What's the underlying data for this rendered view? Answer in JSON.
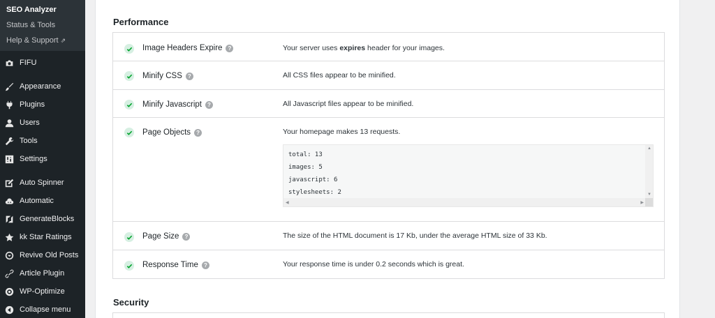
{
  "sidebar": {
    "submenu": [
      {
        "label": "SEO Analyzer",
        "current": true
      },
      {
        "label": "Status & Tools",
        "current": false
      },
      {
        "label": "Help & Support",
        "current": false,
        "external": "⇗"
      }
    ],
    "items": [
      {
        "label": "FIFU",
        "icon": "camera-icon"
      },
      {
        "label": "Appearance",
        "icon": "brush-icon"
      },
      {
        "label": "Plugins",
        "icon": "plugin-icon"
      },
      {
        "label": "Users",
        "icon": "users-icon"
      },
      {
        "label": "Tools",
        "icon": "wrench-icon"
      },
      {
        "label": "Settings",
        "icon": "settings-icon"
      },
      {
        "label": "Auto Spinner",
        "icon": "edit-icon"
      },
      {
        "label": "Automatic",
        "icon": "cloud-icon"
      },
      {
        "label": "GenerateBlocks",
        "icon": "blocks-icon"
      },
      {
        "label": "kk Star Ratings",
        "icon": "star-icon"
      },
      {
        "label": "Revive Old Posts",
        "icon": "revive-icon"
      },
      {
        "label": "Article Plugin",
        "icon": "link-icon"
      },
      {
        "label": "WP-Optimize",
        "icon": "optimize-icon"
      },
      {
        "label": "Collapse menu",
        "icon": "collapse-icon"
      }
    ]
  },
  "main": {
    "performance_title": "Performance",
    "security_title": "Security",
    "rows": [
      {
        "label": "Image Headers Expire",
        "desc_pre": "Your server uses ",
        "desc_bold": "expires",
        "desc_post": " header for your images."
      },
      {
        "label": "Minify CSS",
        "desc_pre": "All CSS files appear to be minified.",
        "desc_bold": "",
        "desc_post": ""
      },
      {
        "label": "Minify Javascript",
        "desc_pre": "All Javascript files appear to be minified.",
        "desc_bold": "",
        "desc_post": ""
      },
      {
        "label": "Page Objects",
        "desc_pre": "Your homepage makes 13 requests.",
        "desc_bold": "",
        "desc_post": ""
      },
      {
        "label": "Page Size",
        "desc_pre": "The size of the HTML document is 17 Kb, under the average HTML size of 33 Kb.",
        "desc_bold": "",
        "desc_post": ""
      },
      {
        "label": "Response Time",
        "desc_pre": "Your response time is under 0.2 seconds which is great.",
        "desc_bold": "",
        "desc_post": ""
      }
    ],
    "code_lines": [
      "total: 13",
      "images: 5",
      "javascript: 6",
      "stylesheets: 2"
    ],
    "colors": {
      "check_bg": "#d6efe2",
      "check": "#00a32a",
      "sidebar": "#1d2327"
    }
  }
}
